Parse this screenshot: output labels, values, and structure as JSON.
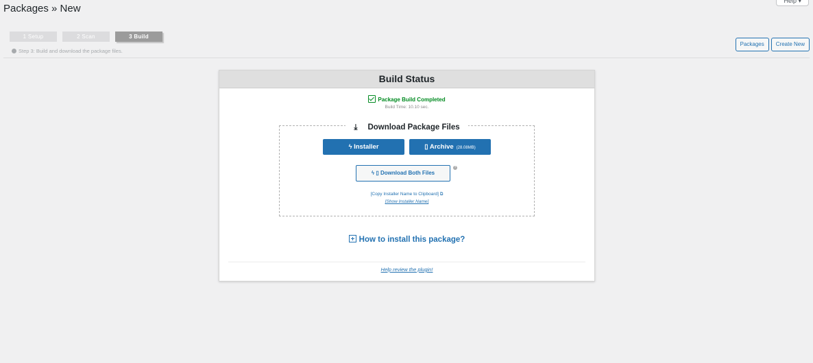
{
  "header": {
    "title": "Packages » New",
    "help_label": "Help ▾"
  },
  "steps": {
    "items": [
      {
        "label": "1 Setup"
      },
      {
        "label": "2 Scan"
      },
      {
        "label": "3 Build"
      }
    ],
    "description": "Step 3: Build and download the package files."
  },
  "toolbar": {
    "packages_label": "Packages",
    "create_new_label": "Create New"
  },
  "panel": {
    "title": "Build Status",
    "completed_text": "Package Build Completed",
    "build_time": "Build Time: 10.10 sec.",
    "download_title": "Download Package Files",
    "installer_label": "Installer",
    "archive_label": "Archive",
    "archive_size": "(28.08MB)",
    "both_label": "Download Both Files",
    "copy_link": "[Copy Installer Name to Clipboard]",
    "show_link": "[Show Installer Name]",
    "howto_label": "How to install this package?",
    "review_link": "Help review the plugin!"
  },
  "colors": {
    "accent": "#2271b1",
    "success": "#008a20",
    "header_bg": "#dfdfdf"
  }
}
